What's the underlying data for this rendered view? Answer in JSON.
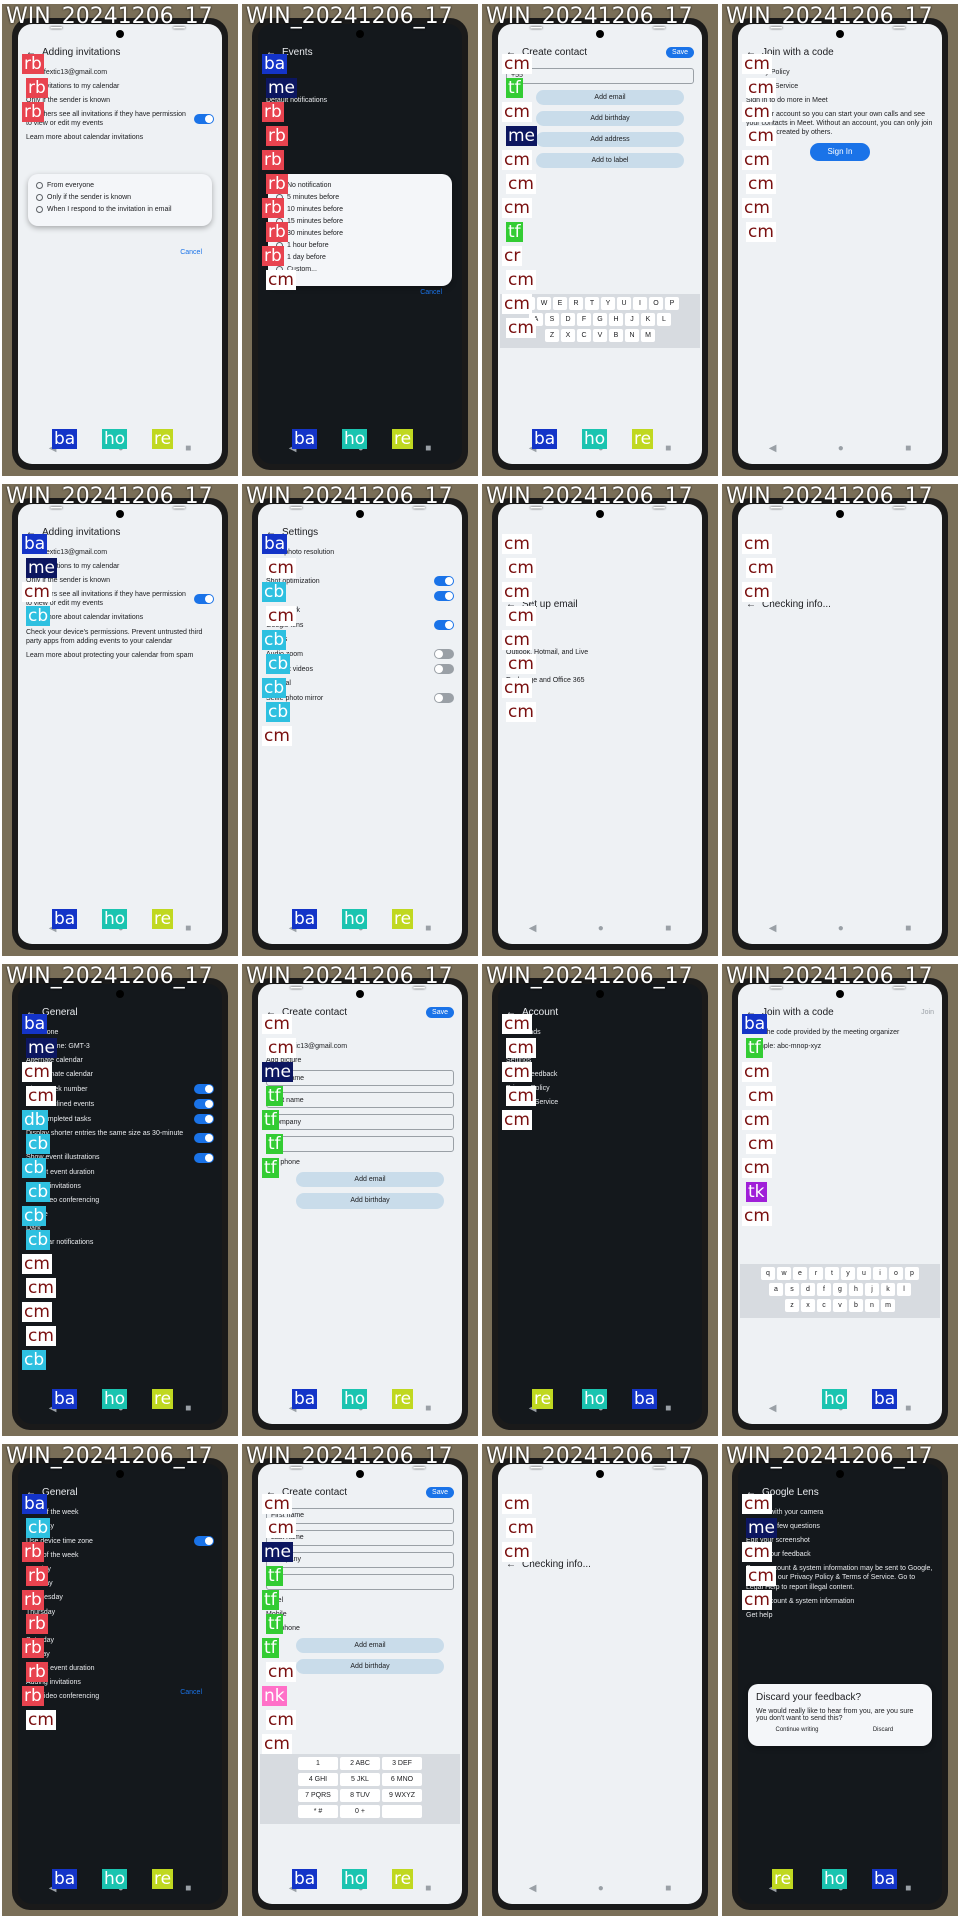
{
  "tiles": [
    {
      "caption": "WIN_20241206_17",
      "theme": "light",
      "title": "Adding invitations",
      "lines": [
        "cinselfextic13@gmail.com",
        "Add invitations to my calendar",
        "Only if the sender is known",
        "Let others see all invitations if they have permission to view or edit my events",
        "Learn more about calendar invitations"
      ],
      "dialog": [
        "From everyone",
        "Only if the sender is known",
        "When I respond to the invitation in email"
      ],
      "dialog_action": "Cancel",
      "tags": [
        "rb",
        "rb",
        "rb",
        "ba",
        "ho",
        "re"
      ]
    },
    {
      "caption": "WIN_20241206_17",
      "theme": "dark",
      "title": "Events",
      "lines": [
        "Color",
        "Peacock",
        "Default notifications"
      ],
      "dialog": [
        "No notification",
        "5 minutes before",
        "10 minutes before",
        "15 minutes before",
        "30 minutes before",
        "1 hour before",
        "1 day before",
        "Custom..."
      ],
      "dialog_action": "Cancel",
      "tags": [
        "ba",
        "me",
        "rb",
        "rb",
        "rb",
        "rb",
        "rb",
        "rb",
        "rb",
        "cm",
        "ba",
        "ho",
        "re"
      ]
    },
    {
      "caption": "WIN_20241206_17",
      "theme": "light",
      "title": "Create contact",
      "save": "Save",
      "lines": [
        "+55",
        "Add email",
        "Add birthday",
        "Add address",
        "Add to label"
      ],
      "keyboard": [
        [
          "Q",
          "W",
          "E",
          "R",
          "T",
          "Y",
          "U",
          "I",
          "O",
          "P"
        ],
        [
          "A",
          "S",
          "D",
          "F",
          "G",
          "H",
          "J",
          "K",
          "L"
        ],
        [
          "Z",
          "X",
          "C",
          "V",
          "B",
          "N",
          "M"
        ]
      ],
      "tags": [
        "cm",
        "tf",
        "cm",
        "me",
        "cm",
        "cm",
        "cm",
        "tf",
        "cr",
        "cm",
        "cm",
        "cm",
        "ba",
        "ho",
        "re"
      ]
    },
    {
      "caption": "WIN_20241206_17",
      "theme": "light",
      "title": "Join with a code",
      "button": "Sign In",
      "lines": [
        "Privacy Policy",
        "Terms of Service",
        "Sign in to do more in Meet",
        "Add your account so you can start your own calls and see your contacts in Meet. Without an account, you can only join meetings created by others."
      ],
      "tags": [
        "cm",
        "cm",
        "cm",
        "cm",
        "cm",
        "cm",
        "cm",
        "cm"
      ]
    },
    {
      "caption": "WIN_20241206_17",
      "theme": "light",
      "title": "Adding invitations",
      "lines": [
        "cinselfextic13@gmail.com",
        "Add invitations to my calendar",
        "Only if the sender is known",
        "Let others see all invitations if they have permission to view or edit my events",
        "Learn more about calendar invitations",
        "Check your device's permissions. Prevent untrusted third party apps from adding events to your calendar",
        "Learn more about protecting your calendar from spam"
      ],
      "tags": [
        "ba",
        "me",
        "cm",
        "cb",
        "ba",
        "ho",
        "re"
      ]
    },
    {
      "caption": "WIN_20241206_17",
      "theme": "light",
      "title": "Settings",
      "lines": [
        "Front photo resolution",
        "Standard",
        "Shot optimization",
        "HDR",
        "Watermark",
        "Google lens",
        "Videos",
        "Audio zoom",
        "Efficient videos",
        "General",
        "Selfie photo mirror"
      ],
      "tags": [
        "ba",
        "cm",
        "cb",
        "cm",
        "cb",
        "cb",
        "cb",
        "cb",
        "cm",
        "ba",
        "ho",
        "re"
      ]
    },
    {
      "caption": "WIN_20241206_17",
      "theme": "light",
      "title": "Set up email",
      "lines": [
        "Google",
        "Outlook, Hotmail, and Live",
        "Yahoo",
        "Exchange and Office 365",
        "Other"
      ],
      "tags": [
        "cm",
        "cm",
        "cm",
        "cm",
        "cm",
        "cm",
        "cm",
        "cm"
      ]
    },
    {
      "caption": "WIN_20241206_17",
      "theme": "light",
      "title": "Checking info...",
      "lines": [],
      "tags": [
        "cm",
        "cm",
        "cm"
      ]
    },
    {
      "caption": "WIN_20241206_17",
      "theme": "dark",
      "title": "General",
      "lines": [
        "Time zone",
        "Device Time: GMT-3",
        "Alternate calendar",
        "No alternate calendar",
        "Show week number",
        "Show declined events",
        "Dim completed tasks",
        "Display shorter entries the same size as 30-minute entries",
        "Show event illustrations",
        "Default event duration",
        "Adding invitations",
        "Add video conferencing",
        "Theme",
        "Dark",
        "Calendar notifications"
      ],
      "tags": [
        "ba",
        "me",
        "cm",
        "cm",
        "db",
        "cb",
        "cb",
        "cb",
        "cb",
        "cb",
        "cm",
        "cm",
        "cm",
        "cm",
        "cb",
        "ba",
        "ho",
        "re"
      ]
    },
    {
      "caption": "WIN_20241206_17",
      "theme": "light",
      "title": "Create contact",
      "save": "Save",
      "lines": [
        "Save to",
        "cinselfextic13@gmail.com",
        "Add picture",
        "First name",
        "Last name",
        "Company",
        "+55",
        "Add phone",
        "Add email",
        "Add birthday"
      ],
      "tags": [
        "cm",
        "cm",
        "me",
        "tf",
        "tf",
        "tf",
        "tf",
        "ba",
        "ho",
        "re"
      ]
    },
    {
      "caption": "WIN_20241206_17",
      "theme": "dark",
      "title": "Account",
      "lines": [
        "Downloads",
        "Turn in",
        "Settings",
        "Help & feedback",
        "Privacy Policy",
        "Terms of Service"
      ],
      "tags": [
        "cm",
        "cm",
        "cm",
        "cm",
        "cm",
        "re",
        "ho",
        "ba"
      ]
    },
    {
      "caption": "WIN_20241206_17",
      "theme": "light",
      "title": "Join with a code",
      "join": "Join",
      "lines": [
        "Enter the code provided by the meeting organizer",
        "Example: abc-mnop-xyz"
      ],
      "keyboard": [
        [
          "q",
          "w",
          "e",
          "r",
          "t",
          "y",
          "u",
          "i",
          "o",
          "p"
        ],
        [
          "a",
          "s",
          "d",
          "f",
          "g",
          "h",
          "j",
          "k",
          "l"
        ],
        [
          "z",
          "x",
          "c",
          "v",
          "b",
          "n",
          "m"
        ]
      ],
      "tags": [
        "ba",
        "tf",
        "cm",
        "cm",
        "cm",
        "cm",
        "cm",
        "tk",
        "cm",
        "ho",
        "ba"
      ]
    },
    {
      "caption": "WIN_20241206_17",
      "theme": "dark",
      "title": "General",
      "lines": [
        "Start of the week",
        "Saturday",
        "Use device time zone",
        "Start of the week",
        "Monday",
        "Tuesday",
        "Wednesday",
        "Thursday",
        "Friday",
        "Saturday",
        "Sunday",
        "Default event duration",
        "Adding invitations",
        "Add video conferencing"
      ],
      "dialog_action": "Cancel",
      "tags": [
        "ba",
        "cb",
        "rb",
        "rb",
        "rb",
        "rb",
        "rb",
        "rb",
        "rb",
        "cm",
        "ba",
        "ho",
        "re"
      ]
    },
    {
      "caption": "WIN_20241206_17",
      "theme": "light",
      "title": "Create contact",
      "save": "Save",
      "lines": [
        "First name",
        "Last name",
        "Company",
        "+55",
        "Label",
        "Mobile",
        "Add phone",
        "Add email",
        "Add birthday"
      ],
      "numpad": [
        [
          "1",
          "2 ABC",
          "3 DEF"
        ],
        [
          "4 GHI",
          "5 JKL",
          "6 MNO"
        ],
        [
          "7 PQRS",
          "8 TUV",
          "9 WXYZ"
        ],
        [
          "* #",
          "0 +",
          ""
        ]
      ],
      "tags": [
        "cm",
        "cm",
        "me",
        "tf",
        "tf",
        "tf",
        "tf",
        "cm",
        "nk",
        "cm",
        "cm",
        "ba",
        "ho",
        "re"
      ]
    },
    {
      "caption": "WIN_20241206_17",
      "theme": "light",
      "title": "Checking info...",
      "lines": [],
      "tags": [
        "cm",
        "cm",
        "cm"
      ]
    },
    {
      "caption": "WIN_20241206_17",
      "theme": "dark",
      "title": "Google Lens",
      "lines": [
        "Search with your camera",
        "Answer a few questions",
        "Edit your screenshot",
        "Share your feedback",
        "Some account & system information may be sent to Google, subject to our Privacy Policy & Terms of Service. Go to Legal Help to report illegal content.",
        "Your Account & system information",
        "Get help"
      ],
      "dialog": [
        "Discard your feedback?",
        "We would really like to hear from you, are you sure you don't want to send this?"
      ],
      "dialog_buttons": [
        "Continue writing",
        "Discard"
      ],
      "tags": [
        "cm",
        "me",
        "cm",
        "cm",
        "cm",
        "re",
        "ho",
        "ba"
      ]
    }
  ],
  "nav": {
    "back": "◀",
    "home": "●",
    "recent": "■"
  },
  "colors": {
    "accent": "#1a73e8",
    "rb": "#e8434f",
    "cb": "#2ec0e0",
    "tf": "#33cc33",
    "ba": "#1434c8",
    "ho": "#1bc4b0",
    "re": "#c0d820",
    "tk": "#a020d8",
    "nk": "#ff70c8"
  }
}
